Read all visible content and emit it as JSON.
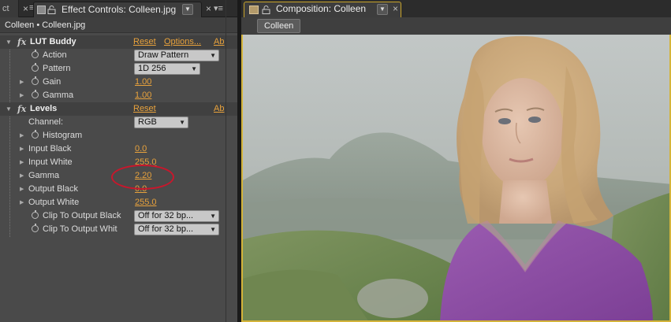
{
  "left_panel": {
    "stub_tab_label": "ct",
    "tab_label": "Effect Controls: Colleen.jpg",
    "breadcrumb": "Colleen • Colleen.jpg",
    "lut": {
      "name": "LUT Buddy",
      "reset": "Reset",
      "options": "Options...",
      "about": "Ab",
      "action_label": "Action",
      "action_value": "Draw Pattern",
      "pattern_label": "Pattern",
      "pattern_value": "1D 256",
      "gain_label": "Gain",
      "gain_value": "1.00",
      "gamma_label": "Gamma",
      "gamma_value": "1.00"
    },
    "levels": {
      "name": "Levels",
      "reset": "Reset",
      "about": "Ab",
      "channel_label": "Channel:",
      "channel_value": "RGB",
      "histogram_label": "Histogram",
      "input_black_label": "Input Black",
      "input_black_value": "0.0",
      "input_white_label": "Input White",
      "input_white_value": "255.0",
      "gamma_label": "Gamma",
      "gamma_value": "2.20",
      "output_black_label": "Output Black",
      "output_black_value": "0.0",
      "output_white_label": "Output White",
      "output_white_value": "255.0",
      "clip_black_label": "Clip To Output Black",
      "clip_black_value": "Off for 32 bp...",
      "clip_white_label": "Clip To Output Whit",
      "clip_white_value": "Off for 32 bp..."
    }
  },
  "right_panel": {
    "tab_label": "Composition: Colleen",
    "crumb_label": "Colleen"
  },
  "colors": {
    "accent_value": "#e8a23c",
    "annotation": "#c8172c",
    "active_border": "#d4b43a"
  }
}
